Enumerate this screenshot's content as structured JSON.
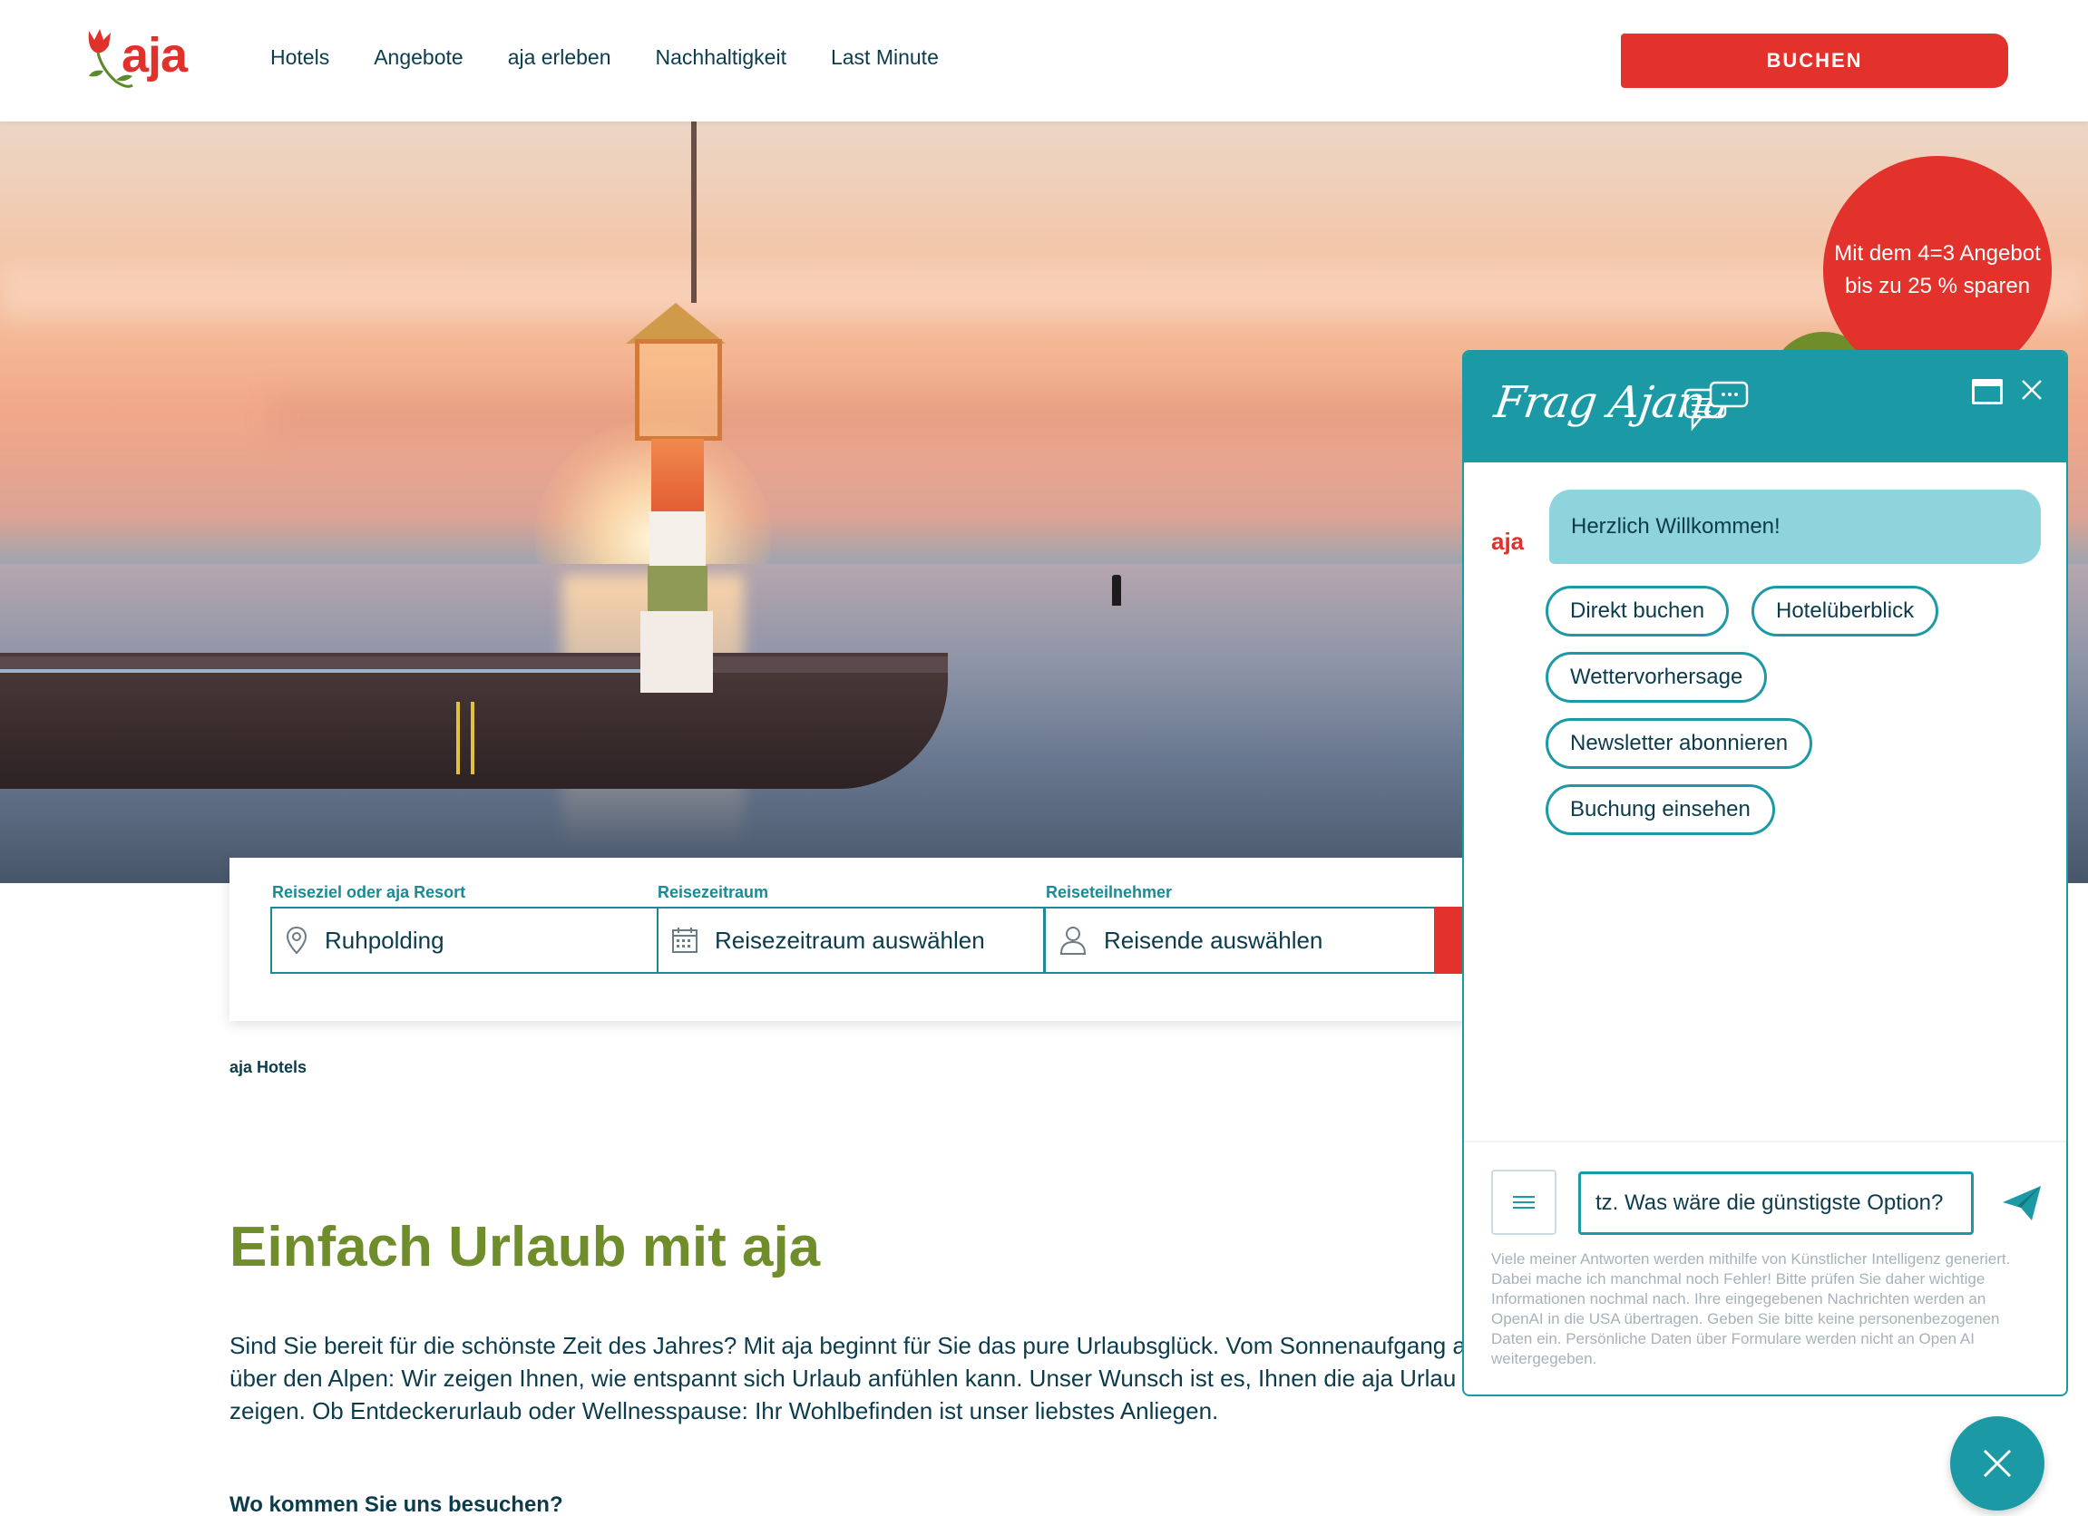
{
  "header": {
    "logo_text": "aja",
    "nav": [
      "Hotels",
      "Angebote",
      "aja erleben",
      "Nachhaltigkeit",
      "Last Minute"
    ],
    "book_label": "BUCHEN"
  },
  "hero": {
    "promo_text": "Mit dem 4=3 Angebot bis zu 25 % sparen"
  },
  "search": {
    "destination_label": "Reiseziel oder aja Resort",
    "destination_value": "Ruhpolding",
    "period_label": "Reisezeitraum",
    "period_value": "Reisezeitraum auswählen",
    "travelers_label": "Reiseteilnehmer",
    "travelers_value": "Reisende auswählen"
  },
  "content": {
    "breadcrumb": "aja Hotels",
    "headline": "Einfach Urlaub mit aja",
    "body": "Sind Sie bereit für die schönste Zeit des Jahres? Mit aja beginnt für Sie das pure Urlaubsglück. Vom Sonnenaufgang a\nüber den Alpen: Wir zeigen Ihnen, wie entspannt sich Urlaub anfühlen kann. Unser Wunsch ist es, Ihnen die aja Urlau\nzeigen. Ob Entdeckerurlaub oder Wellnesspause: Ihr Wohlbefinden ist unser liebstes Anliegen.",
    "subhead": "Wo kommen Sie uns besuchen?"
  },
  "chat": {
    "title": "Frag Ajana",
    "avatar_text": "aja",
    "welcome": "Herzlich Willkommen!",
    "chips": [
      "Direkt buchen",
      "Hotelüberblick",
      "Wettervorhersage",
      "Newsletter abonnieren",
      "Buchung einsehen"
    ],
    "input_value": "tz. Was wäre die günstigste Option?",
    "disclaimer": "Viele meiner Antworten werden mithilfe von Künstlicher Intelligenz generiert. Dabei mache ich manchmal noch Fehler! Bitte prüfen Sie daher wichtige Informationen nochmal nach. Ihre eingegebenen Nachrichten werden an OpenAI in die USA übertragen. Geben Sie bitte keine personenbezogenen Daten ein. Persönliche Daten über Formulare werden nicht an Open AI weitergegeben."
  },
  "colors": {
    "brand_red": "#e3312c",
    "teal": "#1b9aa6",
    "olive": "#6f8d2b",
    "navy_text": "#0c3c4c"
  },
  "icons": [
    "rose-logo-icon",
    "location-pin-icon",
    "calendar-icon",
    "person-icon",
    "chat-bubbles-icon",
    "window-icon",
    "close-icon",
    "menu-icon",
    "send-icon"
  ]
}
